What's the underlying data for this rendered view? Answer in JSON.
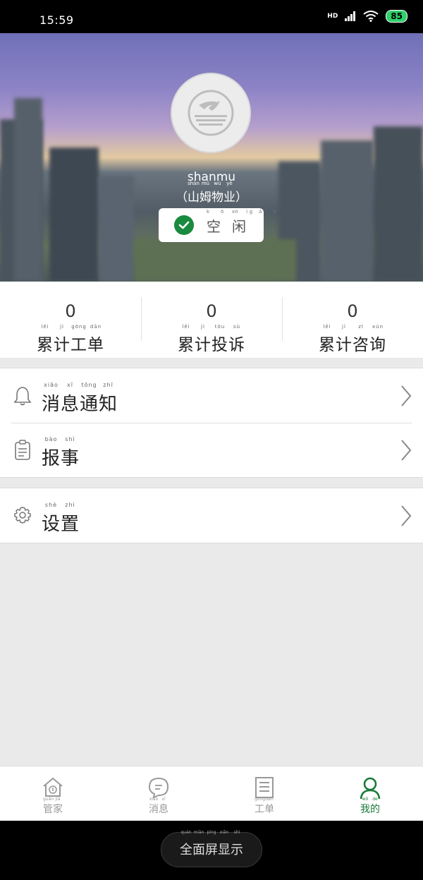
{
  "status_bar": {
    "time": "15:59",
    "battery": "85",
    "network": "HD"
  },
  "profile": {
    "username": "shanmu",
    "company": [
      {
        "t": "（",
        "py": ""
      },
      {
        "t": "山",
        "py": "shān"
      },
      {
        "t": "姆",
        "py": "mǔ"
      },
      {
        "t": "物",
        "py": "wù"
      },
      {
        "t": "业",
        "py": "yè"
      },
      {
        "t": "）",
        "py": ""
      }
    ],
    "status": [
      {
        "t": "空",
        "py": "kōng"
      },
      {
        "t": "闲",
        "py": "xián"
      }
    ]
  },
  "stats": [
    {
      "value": "0",
      "label": [
        {
          "t": "累",
          "py": "lěi"
        },
        {
          "t": "计",
          "py": "jì"
        },
        {
          "t": "工",
          "py": "gōng"
        },
        {
          "t": "单",
          "py": "dān"
        }
      ]
    },
    {
      "value": "0",
      "label": [
        {
          "t": "累",
          "py": "lěi"
        },
        {
          "t": "计",
          "py": "jì"
        },
        {
          "t": "投",
          "py": "tóu"
        },
        {
          "t": "诉",
          "py": "sù"
        }
      ]
    },
    {
      "value": "0",
      "label": [
        {
          "t": "累",
          "py": "lěi"
        },
        {
          "t": "计",
          "py": "jì"
        },
        {
          "t": "咨",
          "py": "zī"
        },
        {
          "t": "询",
          "py": "xún"
        }
      ]
    }
  ],
  "menu": [
    {
      "icon": "bell-icon",
      "label": [
        {
          "t": "消",
          "py": "xiāo"
        },
        {
          "t": "息",
          "py": "xī"
        },
        {
          "t": "通",
          "py": "tōng"
        },
        {
          "t": "知",
          "py": "zhī"
        }
      ]
    },
    {
      "icon": "clipboard-icon",
      "label": [
        {
          "t": "报",
          "py": "bào"
        },
        {
          "t": "事",
          "py": "shì"
        }
      ]
    },
    {
      "icon": "gear-icon",
      "label": [
        {
          "t": "设",
          "py": "shè"
        },
        {
          "t": "置",
          "py": "zhì"
        }
      ]
    }
  ],
  "tabs": [
    {
      "icon": "home-icon",
      "label": [
        {
          "t": "管",
          "py": "guǎn"
        },
        {
          "t": "家",
          "py": "jiā"
        }
      ],
      "active": false
    },
    {
      "icon": "message-icon",
      "label": [
        {
          "t": "消",
          "py": "xiāo"
        },
        {
          "t": "息",
          "py": "xī"
        }
      ],
      "active": false
    },
    {
      "icon": "work-order-icon",
      "label": [
        {
          "t": "工",
          "py": "gōng"
        },
        {
          "t": "单",
          "py": "dān"
        }
      ],
      "active": false
    },
    {
      "icon": "user-icon",
      "label": [
        {
          "t": "我",
          "py": "wǒ"
        },
        {
          "t": "的",
          "py": "de"
        }
      ],
      "active": true
    }
  ],
  "navbar": {
    "fullscreen": [
      {
        "t": "全",
        "py": "quán"
      },
      {
        "t": "面",
        "py": "miàn"
      },
      {
        "t": "屏",
        "py": "píng"
      },
      {
        "t": "显",
        "py": "xiǎn"
      },
      {
        "t": "示",
        "py": "shì"
      }
    ]
  },
  "colors": {
    "accent": "#1a7a3a",
    "check": "#1a8a3e",
    "background": "#eaeaea"
  }
}
